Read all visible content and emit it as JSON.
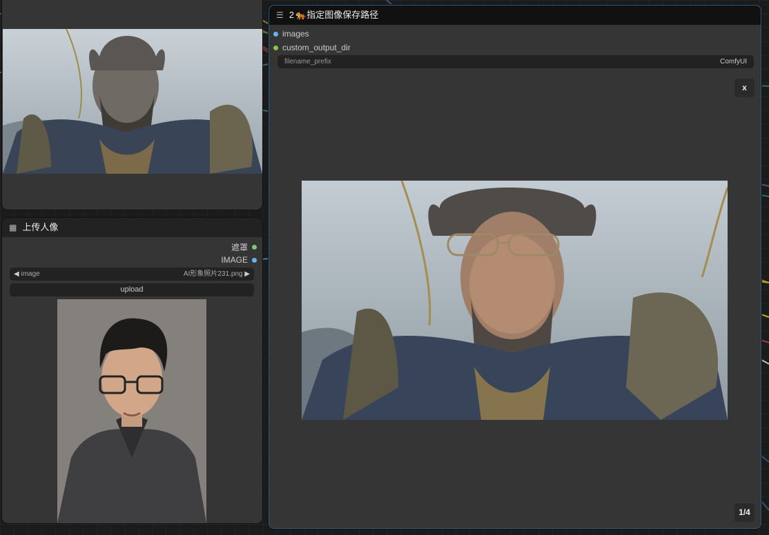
{
  "nodes": {
    "preview_top": {
      "image_alt": "Monkey warrior portrait preview"
    },
    "upload": {
      "title": "上传人像",
      "outputs": [
        {
          "label": "遮罩",
          "color": "#7bc96f"
        },
        {
          "label": "IMAGE",
          "color": "#64b5f6"
        }
      ],
      "image_widget": {
        "label": "image",
        "value": "AI形象照片231.png"
      },
      "upload_label": "upload",
      "image_alt": "Uploaded portrait of young man with glasses"
    },
    "save": {
      "title_number": "2",
      "title_text": "指定图像保存路径",
      "inputs": [
        {
          "label": "images",
          "color": "#64b5f6"
        },
        {
          "label": "custom_output_dir",
          "color": "#8bc34a"
        }
      ],
      "filename_prefix": {
        "label": "filename_prefix",
        "value": "ComfyUI"
      },
      "close_label": "x",
      "page_indicator": "1/4",
      "image_alt": "Generated monkey warrior with face swap"
    }
  },
  "icons": {
    "menu": "hamburger-icon",
    "grid": "grid-icon",
    "emoji": "tiger-emoji-icon",
    "arrow_left": "left-arrow-icon",
    "arrow_right": "right-arrow-icon"
  }
}
